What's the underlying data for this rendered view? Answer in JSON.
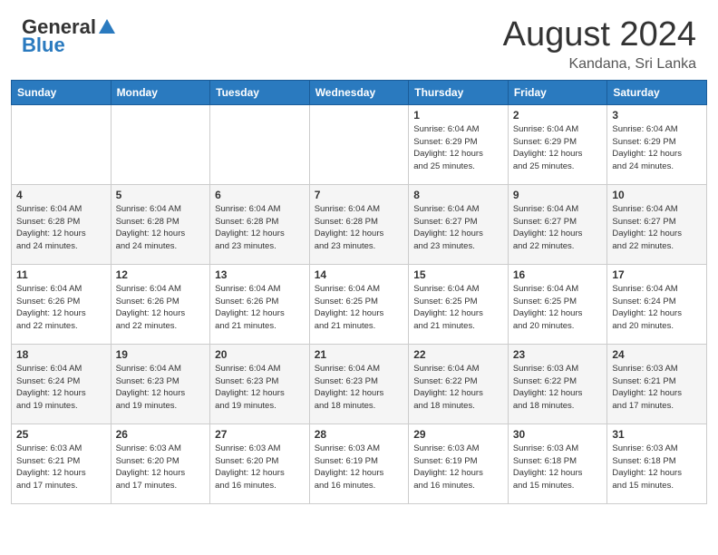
{
  "header": {
    "logo_general": "General",
    "logo_blue": "Blue",
    "month_year": "August 2024",
    "location": "Kandana, Sri Lanka"
  },
  "days_of_week": [
    "Sunday",
    "Monday",
    "Tuesday",
    "Wednesday",
    "Thursday",
    "Friday",
    "Saturday"
  ],
  "weeks": [
    [
      {
        "day": "",
        "info": ""
      },
      {
        "day": "",
        "info": ""
      },
      {
        "day": "",
        "info": ""
      },
      {
        "day": "",
        "info": ""
      },
      {
        "day": "1",
        "info": "Sunrise: 6:04 AM\nSunset: 6:29 PM\nDaylight: 12 hours\nand 25 minutes."
      },
      {
        "day": "2",
        "info": "Sunrise: 6:04 AM\nSunset: 6:29 PM\nDaylight: 12 hours\nand 25 minutes."
      },
      {
        "day": "3",
        "info": "Sunrise: 6:04 AM\nSunset: 6:29 PM\nDaylight: 12 hours\nand 24 minutes."
      }
    ],
    [
      {
        "day": "4",
        "info": "Sunrise: 6:04 AM\nSunset: 6:28 PM\nDaylight: 12 hours\nand 24 minutes."
      },
      {
        "day": "5",
        "info": "Sunrise: 6:04 AM\nSunset: 6:28 PM\nDaylight: 12 hours\nand 24 minutes."
      },
      {
        "day": "6",
        "info": "Sunrise: 6:04 AM\nSunset: 6:28 PM\nDaylight: 12 hours\nand 23 minutes."
      },
      {
        "day": "7",
        "info": "Sunrise: 6:04 AM\nSunset: 6:28 PM\nDaylight: 12 hours\nand 23 minutes."
      },
      {
        "day": "8",
        "info": "Sunrise: 6:04 AM\nSunset: 6:27 PM\nDaylight: 12 hours\nand 23 minutes."
      },
      {
        "day": "9",
        "info": "Sunrise: 6:04 AM\nSunset: 6:27 PM\nDaylight: 12 hours\nand 22 minutes."
      },
      {
        "day": "10",
        "info": "Sunrise: 6:04 AM\nSunset: 6:27 PM\nDaylight: 12 hours\nand 22 minutes."
      }
    ],
    [
      {
        "day": "11",
        "info": "Sunrise: 6:04 AM\nSunset: 6:26 PM\nDaylight: 12 hours\nand 22 minutes."
      },
      {
        "day": "12",
        "info": "Sunrise: 6:04 AM\nSunset: 6:26 PM\nDaylight: 12 hours\nand 22 minutes."
      },
      {
        "day": "13",
        "info": "Sunrise: 6:04 AM\nSunset: 6:26 PM\nDaylight: 12 hours\nand 21 minutes."
      },
      {
        "day": "14",
        "info": "Sunrise: 6:04 AM\nSunset: 6:25 PM\nDaylight: 12 hours\nand 21 minutes."
      },
      {
        "day": "15",
        "info": "Sunrise: 6:04 AM\nSunset: 6:25 PM\nDaylight: 12 hours\nand 21 minutes."
      },
      {
        "day": "16",
        "info": "Sunrise: 6:04 AM\nSunset: 6:25 PM\nDaylight: 12 hours\nand 20 minutes."
      },
      {
        "day": "17",
        "info": "Sunrise: 6:04 AM\nSunset: 6:24 PM\nDaylight: 12 hours\nand 20 minutes."
      }
    ],
    [
      {
        "day": "18",
        "info": "Sunrise: 6:04 AM\nSunset: 6:24 PM\nDaylight: 12 hours\nand 19 minutes."
      },
      {
        "day": "19",
        "info": "Sunrise: 6:04 AM\nSunset: 6:23 PM\nDaylight: 12 hours\nand 19 minutes."
      },
      {
        "day": "20",
        "info": "Sunrise: 6:04 AM\nSunset: 6:23 PM\nDaylight: 12 hours\nand 19 minutes."
      },
      {
        "day": "21",
        "info": "Sunrise: 6:04 AM\nSunset: 6:23 PM\nDaylight: 12 hours\nand 18 minutes."
      },
      {
        "day": "22",
        "info": "Sunrise: 6:04 AM\nSunset: 6:22 PM\nDaylight: 12 hours\nand 18 minutes."
      },
      {
        "day": "23",
        "info": "Sunrise: 6:03 AM\nSunset: 6:22 PM\nDaylight: 12 hours\nand 18 minutes."
      },
      {
        "day": "24",
        "info": "Sunrise: 6:03 AM\nSunset: 6:21 PM\nDaylight: 12 hours\nand 17 minutes."
      }
    ],
    [
      {
        "day": "25",
        "info": "Sunrise: 6:03 AM\nSunset: 6:21 PM\nDaylight: 12 hours\nand 17 minutes."
      },
      {
        "day": "26",
        "info": "Sunrise: 6:03 AM\nSunset: 6:20 PM\nDaylight: 12 hours\nand 17 minutes."
      },
      {
        "day": "27",
        "info": "Sunrise: 6:03 AM\nSunset: 6:20 PM\nDaylight: 12 hours\nand 16 minutes."
      },
      {
        "day": "28",
        "info": "Sunrise: 6:03 AM\nSunset: 6:19 PM\nDaylight: 12 hours\nand 16 minutes."
      },
      {
        "day": "29",
        "info": "Sunrise: 6:03 AM\nSunset: 6:19 PM\nDaylight: 12 hours\nand 16 minutes."
      },
      {
        "day": "30",
        "info": "Sunrise: 6:03 AM\nSunset: 6:18 PM\nDaylight: 12 hours\nand 15 minutes."
      },
      {
        "day": "31",
        "info": "Sunrise: 6:03 AM\nSunset: 6:18 PM\nDaylight: 12 hours\nand 15 minutes."
      }
    ]
  ]
}
